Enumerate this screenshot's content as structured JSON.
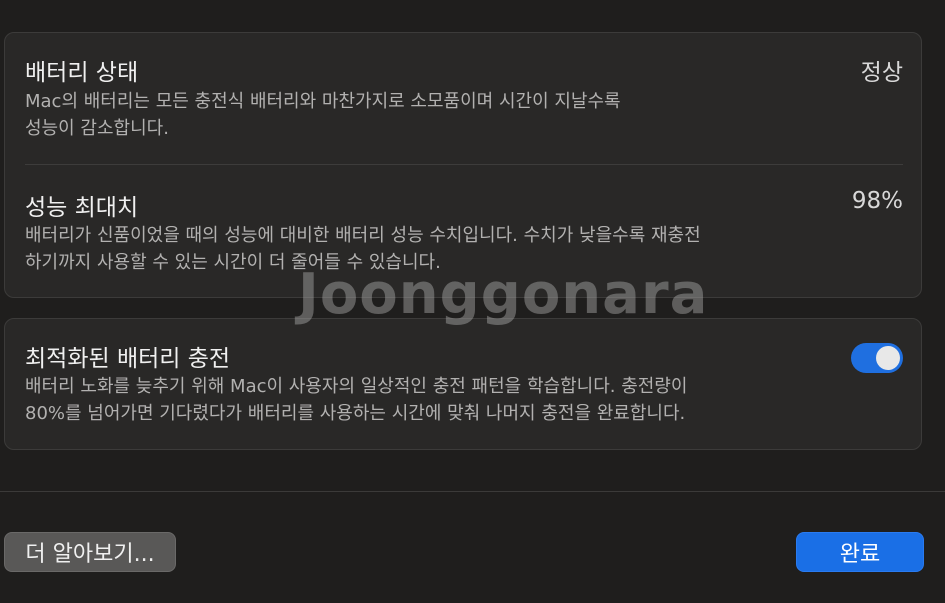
{
  "battery_health": {
    "title": "배터리 상태",
    "value": "정상",
    "description_lines": [
      "Mac의 배터리는 모든 충전식 배터리와 마찬가지로 소모품이며 시간이 지날수록",
      "성능이 감소합니다."
    ]
  },
  "max_capacity": {
    "title": "성능 최대치",
    "value": "98%",
    "description_lines": [
      "배터리가 신품이었을 때의 성능에 대비한 배터리 성능 수치입니다. 수치가 낮을수록 재충전",
      "하기까지 사용할 수 있는 시간이 더 줄어들 수 있습니다."
    ]
  },
  "optimized_charging": {
    "title": "최적화된 배터리 충전",
    "enabled": true,
    "description_lines": [
      "배터리 노화를 늦추기 위해 Mac이 사용자의 일상적인 충전 패턴을 학습합니다. 충전량이",
      "80%를 넘어가면 기다렸다가 배터리를 사용하는 시간에 맞춰 나머지 충전을 완료합니다."
    ]
  },
  "footer": {
    "learn_more_label": "더 알아보기...",
    "done_label": "완료"
  },
  "watermark": {
    "text": "Joonggonara"
  },
  "colors": {
    "background": "#1f1e1d",
    "card": "#292827",
    "accent": "#1a6fe6",
    "toggle_on": "#1f6fe0"
  }
}
